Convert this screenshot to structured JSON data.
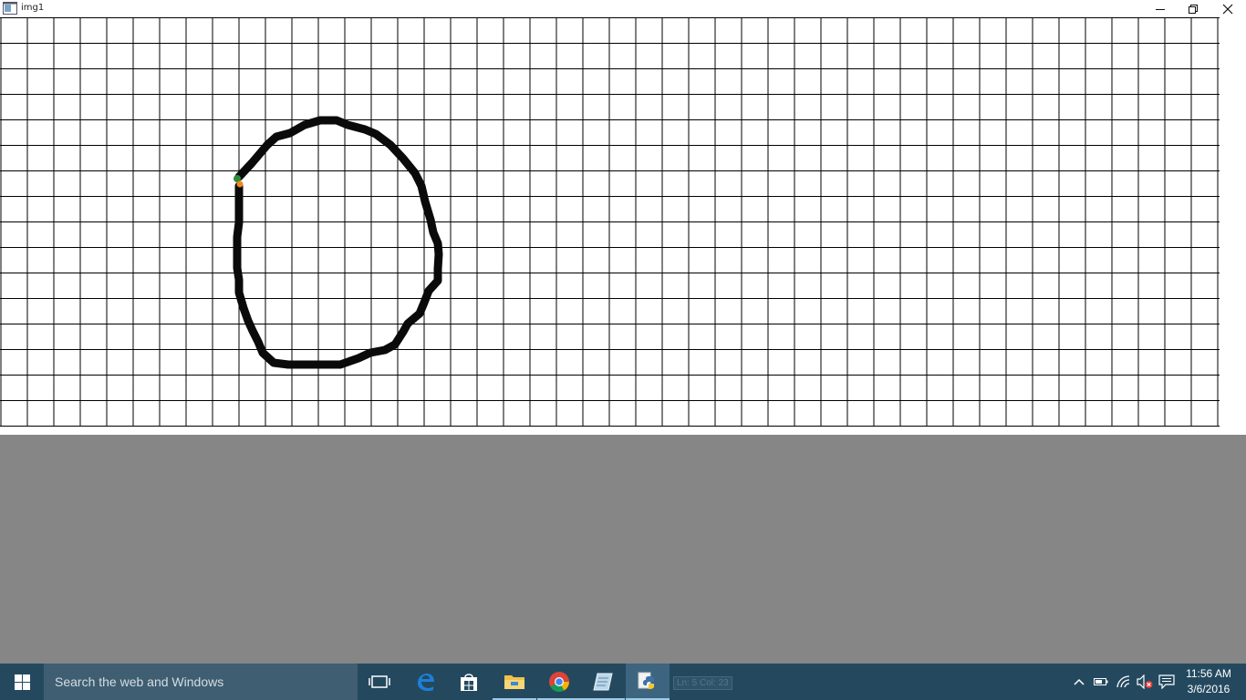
{
  "window": {
    "title": "img1",
    "icon": "app-window-icon",
    "controls": [
      "minimize-icon",
      "restore-icon",
      "close-icon"
    ]
  },
  "canvas": {
    "background": "#ffffff",
    "grid_color": "#000000",
    "stroke_color": "#0a0a0a",
    "marker_start_color": "#2e8b3d",
    "marker_end_color": "#f08a1c"
  },
  "taskbar": {
    "search_placeholder": "Search the web and Windows",
    "pinned": [
      {
        "name": "task-view-icon"
      },
      {
        "name": "edge-icon"
      },
      {
        "name": "store-icon"
      },
      {
        "name": "file-explorer-icon"
      },
      {
        "name": "chrome-icon"
      },
      {
        "name": "notepad-icon"
      },
      {
        "name": "python-icon"
      }
    ],
    "ghost_status": "Ln: 5  Col: 23",
    "tray": [
      "chevron-up-icon",
      "battery-icon",
      "wifi-icon",
      "volume-muted-icon",
      "notifications-icon"
    ],
    "clock_time": "11:56 AM",
    "clock_date": "3/6/2016"
  }
}
